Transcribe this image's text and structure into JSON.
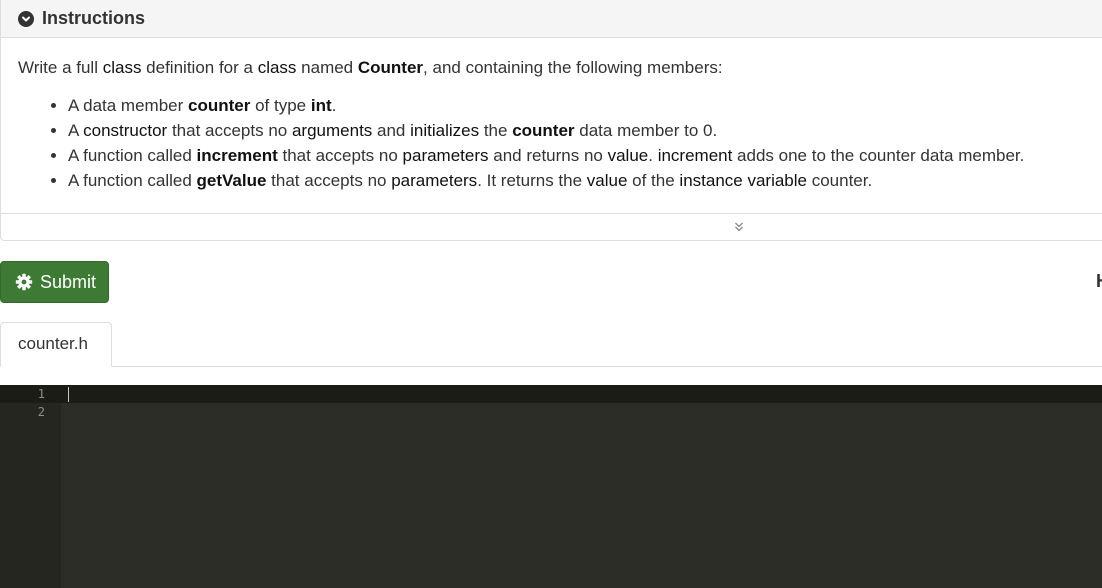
{
  "instructions": {
    "title": "Instructions",
    "intro": [
      "Write a full ",
      "class",
      " definition for a ",
      "class",
      " named ",
      "Counter",
      ", and containing the following members:"
    ],
    "members": [
      [
        "A data member ",
        "counter",
        " of type ",
        "int",
        "."
      ],
      [
        "A ",
        "constructor",
        " that accepts no ",
        "arguments",
        " and ",
        "initializes",
        " the ",
        "counter",
        " data member to 0."
      ],
      [
        "A function called ",
        "increment",
        " that accepts no ",
        "parameters",
        " and returns no ",
        "value",
        ". ",
        "increment",
        " adds one to the counter data member."
      ],
      [
        "A function called ",
        "getValue",
        " that accepts no ",
        "parameters",
        ". It returns the ",
        "value",
        " of the ",
        "instance variable",
        " counter."
      ]
    ]
  },
  "actions": {
    "submit_label": "Submit"
  },
  "right_edge_text": "H",
  "file_tabs": [
    {
      "label": "counter.h",
      "active": true
    }
  ],
  "editor": {
    "line_numbers": [
      "1",
      "2"
    ],
    "content": ""
  },
  "colors": {
    "submit": "#3d7a34",
    "editor_bg": "#2c2d27",
    "gutter_bg": "#25261f"
  }
}
